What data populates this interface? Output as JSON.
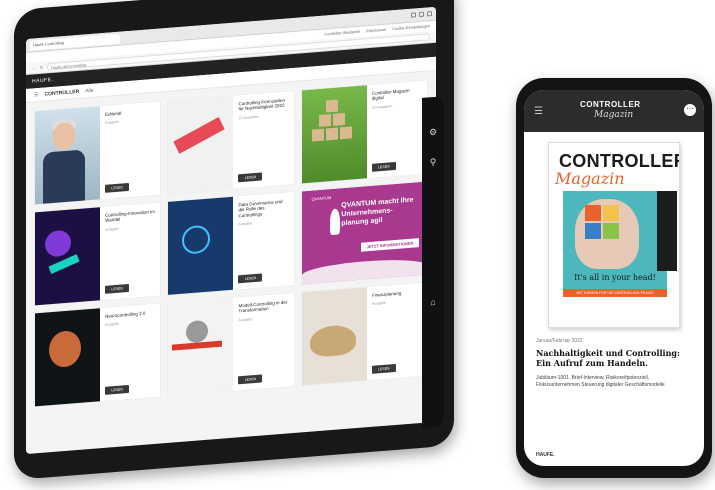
{
  "tablet": {
    "browser": {
      "tab_label": "Haufe Controlling",
      "url": "haufe.de/controlling",
      "toplinks": [
        "Controller Akademie",
        "Impressum",
        "Cookie-Einstellungen"
      ]
    },
    "app_header": "HAUFE.",
    "sub_header": {
      "logo": "CONTROLLER",
      "crumb": "Alle"
    },
    "cards": [
      {
        "title": "Editorial",
        "meta": "Ausgabe",
        "button": "LESEN",
        "thumb": "person"
      },
      {
        "title": "Controlling Kennzahlen für Nachhaltigkeit 2022",
        "meta": "12 Ausgaben",
        "button": "LESEN",
        "thumb": "arrow"
      },
      {
        "title": "Controller Magazin digital",
        "meta": "12 Ausgaben",
        "button": "LESEN",
        "thumb": "cube"
      },
      {
        "title": "Controlling-Innovation im Wandel",
        "meta": "Ausgabe",
        "button": "LESEN",
        "thumb": "neon"
      },
      {
        "title": "Data Governance und die Rolle des Controllings",
        "meta": "Ausgabe",
        "button": "LESEN",
        "thumb": "tech"
      },
      {
        "promo": true,
        "title": "QVANTUM macht Ihre Unternehmens-planung agil",
        "button": "JETZT INFORMATIONEN",
        "logo": "QVANTUM"
      },
      {
        "title": "Neurocontrolling 2.0",
        "meta": "Ausgabe",
        "button": "LESEN",
        "thumb": "brain"
      },
      {
        "title": "Modell-Controlling in der Transformation",
        "meta": "Ausgabe",
        "button": "LESEN",
        "thumb": "ball"
      },
      {
        "title": "Finanzplanung",
        "meta": "Ausgabe",
        "button": "LESEN",
        "thumb": "grain"
      }
    ]
  },
  "phone": {
    "header": {
      "logo_top": "CONTROLLER",
      "logo_script": "Magazin"
    },
    "cover": {
      "title": "CONTROLLER",
      "script": "Magazin",
      "tagline": "It's all in your head!",
      "bar_text": "MIT THEMEN FÜR DIE CONTROLLING-PRAXIS"
    },
    "date": "Januar/Februar 2022",
    "article_title": "Nachhaltigkeit und Controlling: Ein Aufruf zum Handeln.",
    "article_desc": "Jubiläum-1001. Brief-Interview, Risikoreifpotenziell, Fiskusunternehmen Steuerung digitaler Geschäftsmodelle",
    "footer": "HAUFE."
  },
  "colors": {
    "promo": "#a8398f",
    "cover_accent": "#e8622c",
    "cover_teal": "#4cb8bd"
  }
}
